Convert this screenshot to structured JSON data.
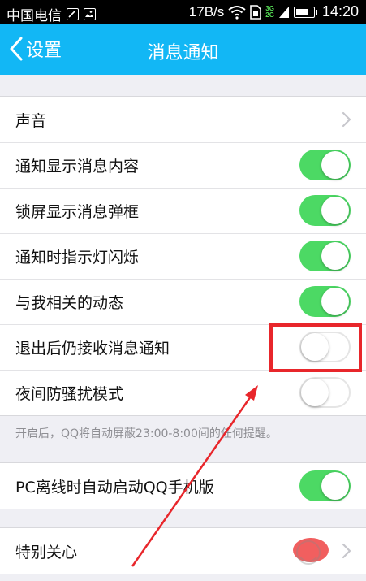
{
  "status_bar": {
    "carrier": "中国电信",
    "net_speed": "17B/s",
    "net_3g": "3G",
    "net_2g": "2G",
    "time": "14:20",
    "battery_level": 0.7
  },
  "nav": {
    "back_label": "设置",
    "title": "消息通知"
  },
  "group1": {
    "rows": [
      {
        "label": "声音",
        "control": "arrow"
      },
      {
        "label": "通知显示消息内容",
        "control": "switch",
        "on": true
      },
      {
        "label": "锁屏显示消息弹框",
        "control": "switch",
        "on": true
      },
      {
        "label": "通知时指示灯闪烁",
        "control": "switch",
        "on": true
      },
      {
        "label": "与我相关的动态",
        "control": "switch",
        "on": true
      },
      {
        "label": "退出后仍接收消息通知",
        "control": "switch",
        "on": false
      },
      {
        "label": "夜间防骚扰模式",
        "control": "switch",
        "on": false
      }
    ]
  },
  "hint": "开启后，QQ将自动屏蔽23:00-8:00间的任何提醒。",
  "group2": {
    "rows": [
      {
        "label": "PC离线时自动启动QQ手机版",
        "control": "switch",
        "on": true
      }
    ]
  },
  "group3": {
    "rows": [
      {
        "label": "特别关心",
        "control": "arrow"
      }
    ]
  },
  "colors": {
    "nav_bg": "#12b7f5",
    "switch_on": "#4cd964",
    "annotation": "#e8262b",
    "page_bg": "#efeff4"
  }
}
